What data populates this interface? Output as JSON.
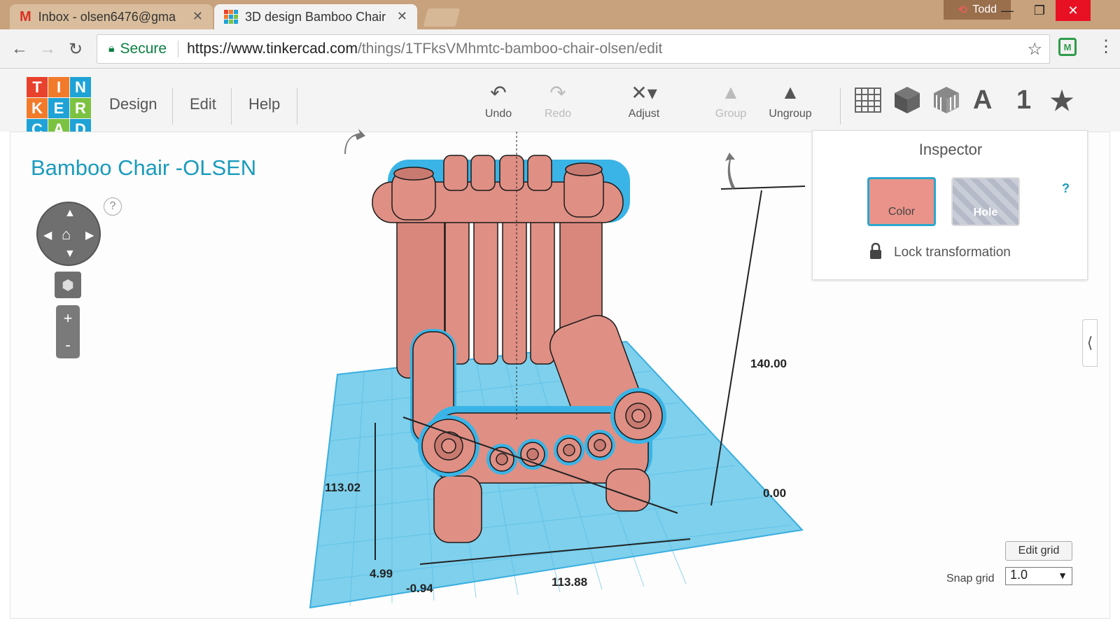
{
  "browser": {
    "tabs": [
      {
        "title": "Inbox - olsen6476@gma",
        "icon": "gmail-icon"
      },
      {
        "title": "3D design Bamboo Chair",
        "icon": "tinkercad-icon"
      }
    ],
    "profile_name": "Todd",
    "secure_label": "Secure",
    "url_host": "https://www.tinkercad.com",
    "url_path": "/things/1TFksVMhmtc-bamboo-chair-olsen/edit"
  },
  "logo_letters": [
    "T",
    "I",
    "N",
    "K",
    "E",
    "R",
    "C",
    "A",
    "D"
  ],
  "logo_colors": [
    "#e8412c",
    "#f27b2b",
    "#1fa3d6",
    "#f27b2b",
    "#1fa3d6",
    "#7cc242",
    "#1fa3d6",
    "#7cc242",
    "#1fa3d6"
  ],
  "menu": {
    "design": "Design",
    "edit": "Edit",
    "help": "Help"
  },
  "toolbar": {
    "undo": "Undo",
    "redo": "Redo",
    "adjust": "Adjust",
    "group": "Group",
    "ungroup": "Ungroup",
    "text_tool": "A",
    "number_tool": "1"
  },
  "title": "Bamboo Chair -OLSEN",
  "help_mark": "?",
  "inspector": {
    "title": "Inspector",
    "color_label": "Color",
    "hole_label": "Hole",
    "help": "?",
    "lock_label": "Lock transformation",
    "selected_color": "#e9938a"
  },
  "dimensions": {
    "height": "140.00",
    "elevation": "0.00",
    "length": "113.02",
    "width": "113.88",
    "offset_y": "4.99",
    "offset_x": "-0.94"
  },
  "grid": {
    "edit_grid": "Edit grid",
    "snap_label": "Snap grid",
    "snap_value": "1.0"
  }
}
